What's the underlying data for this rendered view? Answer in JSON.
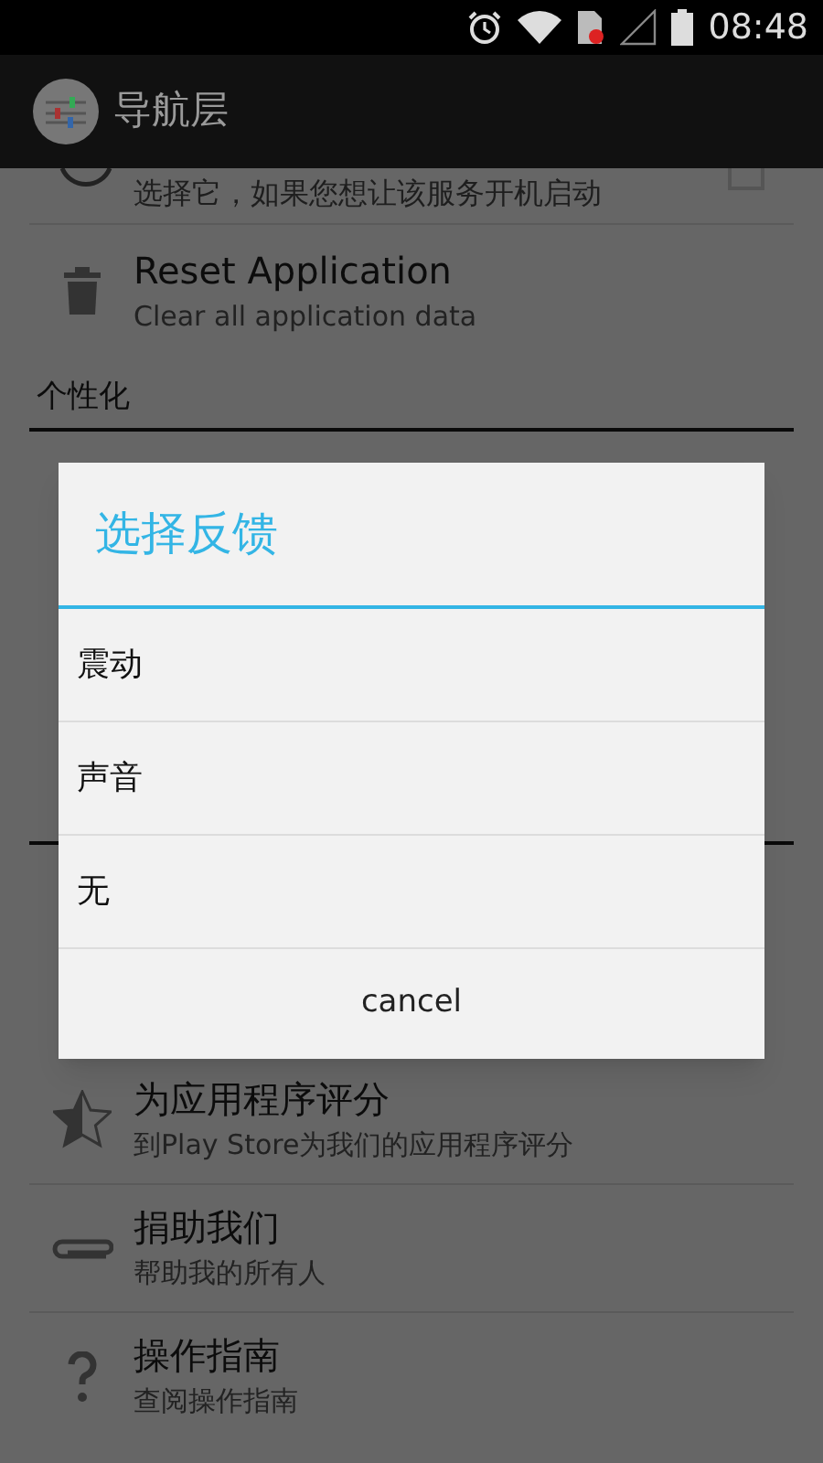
{
  "status_bar": {
    "time": "08:48"
  },
  "action_bar": {
    "title": "导航层"
  },
  "list": [
    {
      "kind": "partial",
      "subtitle": "选择它，如果您想让该服务开机启动",
      "checked": false
    },
    {
      "kind": "item",
      "title": "Reset Application",
      "subtitle": "Clear all application data"
    },
    {
      "kind": "header",
      "title": "个性化"
    },
    {
      "kind": "item",
      "title": "为应用程序评分",
      "subtitle": "到Play Store为我们的应用程序评分"
    },
    {
      "kind": "item",
      "title": "捐助我们",
      "subtitle": "帮助我的所有人"
    },
    {
      "kind": "item",
      "title": "操作指南",
      "subtitle": "查阅操作指南"
    }
  ],
  "dialog": {
    "title": "选择反馈",
    "options": [
      "震动",
      "声音",
      "无"
    ],
    "cancel": "cancel"
  }
}
